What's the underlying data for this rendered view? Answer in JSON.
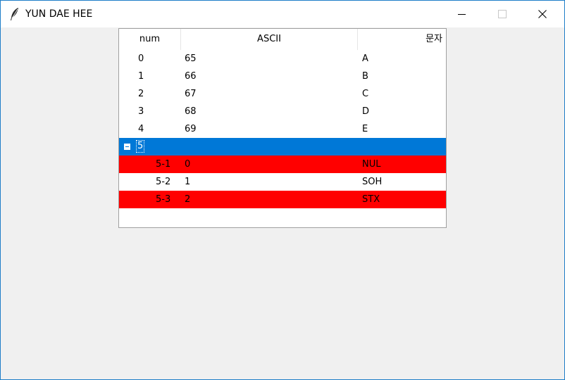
{
  "window": {
    "title": "YUN DAE HEE",
    "icons": {
      "app": "feather-icon",
      "minimize": "minimize-icon",
      "maximize": "maximize-icon",
      "close": "close-icon"
    }
  },
  "tree": {
    "columns": [
      "num",
      "ASCII",
      "문자"
    ],
    "rows": [
      {
        "num": "0",
        "ascii": "65",
        "char": "A"
      },
      {
        "num": "1",
        "ascii": "66",
        "char": "B"
      },
      {
        "num": "2",
        "ascii": "67",
        "char": "C"
      },
      {
        "num": "3",
        "ascii": "68",
        "char": "D"
      },
      {
        "num": "4",
        "ascii": "69",
        "char": "E"
      }
    ],
    "parent": {
      "num": "5",
      "expanded": true,
      "selected": true
    },
    "children": [
      {
        "num": "5-1",
        "ascii": "0",
        "char": "NUL",
        "highlight": "#ff0000"
      },
      {
        "num": "5-2",
        "ascii": "1",
        "char": "SOH",
        "highlight": null
      },
      {
        "num": "5-3",
        "ascii": "2",
        "char": "STX",
        "highlight": "#ff0000"
      }
    ]
  },
  "colors": {
    "selection": "#0078d7",
    "highlight_red": "#ff0000",
    "window_border": "#1e7ec8",
    "background": "#f0f0f0"
  }
}
